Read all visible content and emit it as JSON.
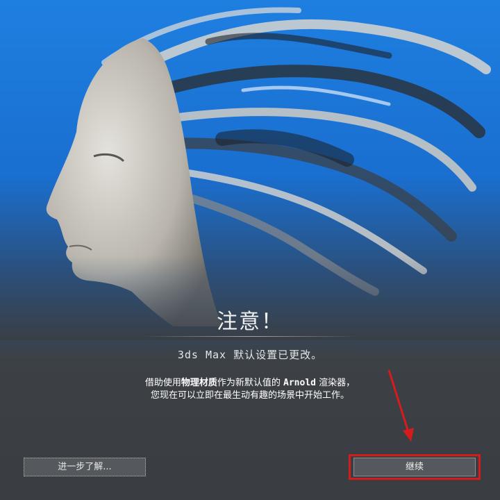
{
  "dialog": {
    "title": "注意！",
    "subtitle": "3ds Max 默认设置已更改。",
    "description": {
      "line1_pre": "借助使用",
      "line1_bold": "物理材质",
      "line1_mid": "作为新默认值的 ",
      "line1_mono": "Arnold",
      "line1_post": " 渲染器，",
      "line2": "您现在可以立即在最生动有趣的场景中开始工作。"
    },
    "learn_more_label": "进一步了解...",
    "continue_label": "继续"
  },
  "colors": {
    "accent_blue": "#1e7fe0",
    "highlight_red": "#d51c1c",
    "button_bg": "#55585d"
  }
}
